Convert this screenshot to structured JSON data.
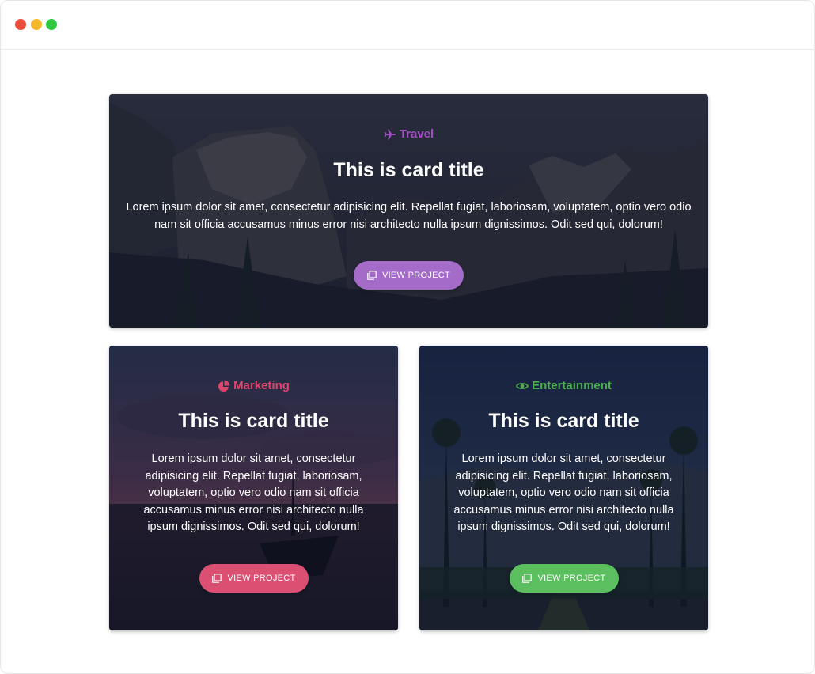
{
  "window": {
    "controls": {
      "close_color": "#ED4C3B",
      "minimize_color": "#F5B62A",
      "maximize_color": "#2BC840"
    }
  },
  "cards": {
    "travel": {
      "category": "Travel",
      "category_icon": "plane-icon",
      "accent": "#A24FC1",
      "title": "This is card title",
      "text": "Lorem ipsum dolor sit amet, consectetur adipisicing elit. Repellat fugiat, laboriosam, voluptatem, optio vero odio nam sit officia accusamus minus error nisi architecto nulla ipsum dignissimos. Odit sed qui, dolorum!",
      "button_label": "VIEW PROJECT",
      "button_icon": "clone-icon",
      "button_color": "#A46BC9"
    },
    "marketing": {
      "category": "Marketing",
      "category_icon": "pie-chart-icon",
      "accent": "#E0456C",
      "title": "This is card title",
      "text": "Lorem ipsum dolor sit amet, consectetur adipisicing elit. Repellat fugiat, laboriosam, voluptatem, optio vero odio nam sit officia accusamus minus error nisi architecto nulla ipsum dignissimos. Odit sed qui, dolorum!",
      "button_label": "VIEW PROJECT",
      "button_icon": "clone-icon",
      "button_color": "#DB4F73"
    },
    "entertainment": {
      "category": "Entertainment",
      "category_icon": "eye-icon",
      "accent": "#4CAF50",
      "title": "This is card title",
      "text": "Lorem ipsum dolor sit amet, consectetur adipisicing elit. Repellat fugiat, laboriosam, voluptatem, optio vero odio nam sit officia accusamus minus error nisi architecto nulla ipsum dignissimos. Odit sed qui, dolorum!",
      "button_label": "VIEW PROJECT",
      "button_icon": "clone-icon",
      "button_color": "#5CBF5F"
    }
  }
}
